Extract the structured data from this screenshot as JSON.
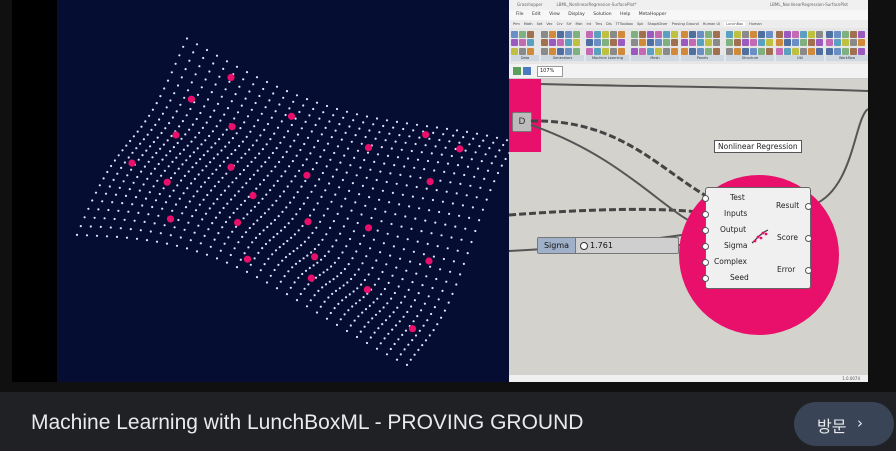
{
  "caption": {
    "title": "Machine Learning with LunchBoxML - PROVING GROUND"
  },
  "visit_button": {
    "label": "방문",
    "chevron": "›"
  },
  "grasshopper": {
    "title_bar": {
      "app": "Grasshopper",
      "file_small": "LBML_NonlinearRegression-SurfacePlot*",
      "file_right": "LBML_NonlinearRegression-SurfacePlot"
    },
    "menu": [
      "File",
      "Edit",
      "View",
      "Display",
      "Solution",
      "Help",
      "MetaHopper"
    ],
    "tabs": [
      "Prm",
      "Math",
      "Set",
      "Vec",
      "Crv",
      "Srf",
      "Msh",
      "Int",
      "Trns",
      "Dis",
      "TTToolbox",
      "Spk",
      "ShapeDiver",
      "Proving Ground",
      "Human UI",
      "LunchBox",
      "Human"
    ],
    "active_tab": "LunchBox",
    "ribbon_groups": [
      "Data",
      "Generators",
      "Machine Learning",
      "Mesh",
      "Panels",
      "Structure",
      "Util",
      "Workflow"
    ],
    "zoom": "107%",
    "status": "1.0.0074",
    "components": {
      "d_node": "D",
      "nlr_title": "Nonlinear Regression",
      "nlr_inputs": [
        "Test",
        "Inputs",
        "Output",
        "Sigma",
        "Complex",
        "Seed"
      ],
      "nlr_outputs": [
        "Result",
        "Score",
        "Error"
      ],
      "sigma_label": "Sigma",
      "sigma_value": "1.761"
    }
  },
  "colors": {
    "accent": "#e8106a",
    "plot_bg": "#050d33",
    "page_bg": "#202124",
    "button_bg": "#394457"
  },
  "icons": [
    "chevron-right-icon",
    "grasshopper-nav-icon",
    "nonlinear-regression-icon"
  ]
}
